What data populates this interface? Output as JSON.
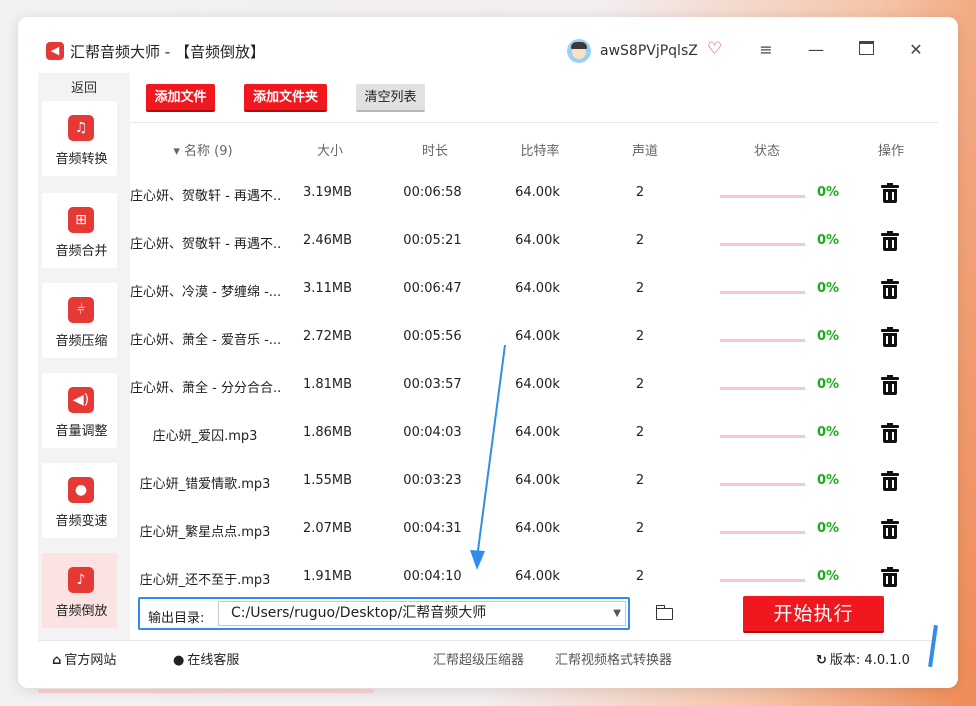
{
  "window": {
    "app_name": "汇帮音频大师",
    "mode": " - 【音频倒放】",
    "username": "awS8PVjPqlsZ"
  },
  "sidebar": {
    "back_label": "返回",
    "items": [
      {
        "label": "音频转换",
        "icon": "audio-convert-icon"
      },
      {
        "label": "音频合并",
        "icon": "audio-merge-icon"
      },
      {
        "label": "音频压缩",
        "icon": "audio-compress-icon"
      },
      {
        "label": "音量调整",
        "icon": "volume-icon"
      },
      {
        "label": "音频变速",
        "icon": "speed-icon"
      },
      {
        "label": "音频倒放",
        "icon": "reverse-icon",
        "active": true
      }
    ]
  },
  "toolbar": {
    "add_file": "添加文件",
    "add_folder": "添加文件夹",
    "clear_list": "清空列表"
  },
  "table": {
    "headers": {
      "name": "▾ 名称 (9)",
      "size": "大小",
      "duration": "时长",
      "bitrate": "比特率",
      "channels": "声道",
      "status": "状态",
      "actions": "操作"
    },
    "rows": [
      {
        "name": "庄心妍、贺敬轩 - 再遇不...",
        "size": "3.19MB",
        "duration": "00:06:58",
        "bitrate": "64.00k",
        "channels": "2",
        "progress": "0%"
      },
      {
        "name": "庄心妍、贺敬轩 - 再遇不...",
        "size": "2.46MB",
        "duration": "00:05:21",
        "bitrate": "64.00k",
        "channels": "2",
        "progress": "0%"
      },
      {
        "name": "庄心妍、冷漠 - 梦缠绵 -...",
        "size": "3.11MB",
        "duration": "00:06:47",
        "bitrate": "64.00k",
        "channels": "2",
        "progress": "0%"
      },
      {
        "name": "庄心妍、萧全 - 爱音乐 -...",
        "size": "2.72MB",
        "duration": "00:05:56",
        "bitrate": "64.00k",
        "channels": "2",
        "progress": "0%"
      },
      {
        "name": "庄心妍、萧全 - 分分合合...",
        "size": "1.81MB",
        "duration": "00:03:57",
        "bitrate": "64.00k",
        "channels": "2",
        "progress": "0%"
      },
      {
        "name": "庄心妍_爱囚.mp3",
        "size": "1.86MB",
        "duration": "00:04:03",
        "bitrate": "64.00k",
        "channels": "2",
        "progress": "0%"
      },
      {
        "name": "庄心妍_错爱情歌.mp3",
        "size": "1.55MB",
        "duration": "00:03:23",
        "bitrate": "64.00k",
        "channels": "2",
        "progress": "0%"
      },
      {
        "name": "庄心妍_繁星点点.mp3",
        "size": "2.07MB",
        "duration": "00:04:31",
        "bitrate": "64.00k",
        "channels": "2",
        "progress": "0%"
      },
      {
        "name": "庄心妍_还不至于.mp3",
        "size": "1.91MB",
        "duration": "00:04:10",
        "bitrate": "64.00k",
        "channels": "2",
        "progress": "0%"
      }
    ]
  },
  "output": {
    "label": "输出目录:",
    "path": "C:/Users/ruguo/Desktop/汇帮音频大师",
    "start_button": "开始执行"
  },
  "footer": {
    "website": "官方网站",
    "support": "在线客服",
    "link1": "汇帮超级压缩器",
    "link2": "汇帮视频格式转换器",
    "version": "版本: 4.0.1.0"
  },
  "colors": {
    "brand_red": "#f0171e",
    "progress_green": "#1aad19",
    "highlight_blue": "#2f8fe8"
  }
}
